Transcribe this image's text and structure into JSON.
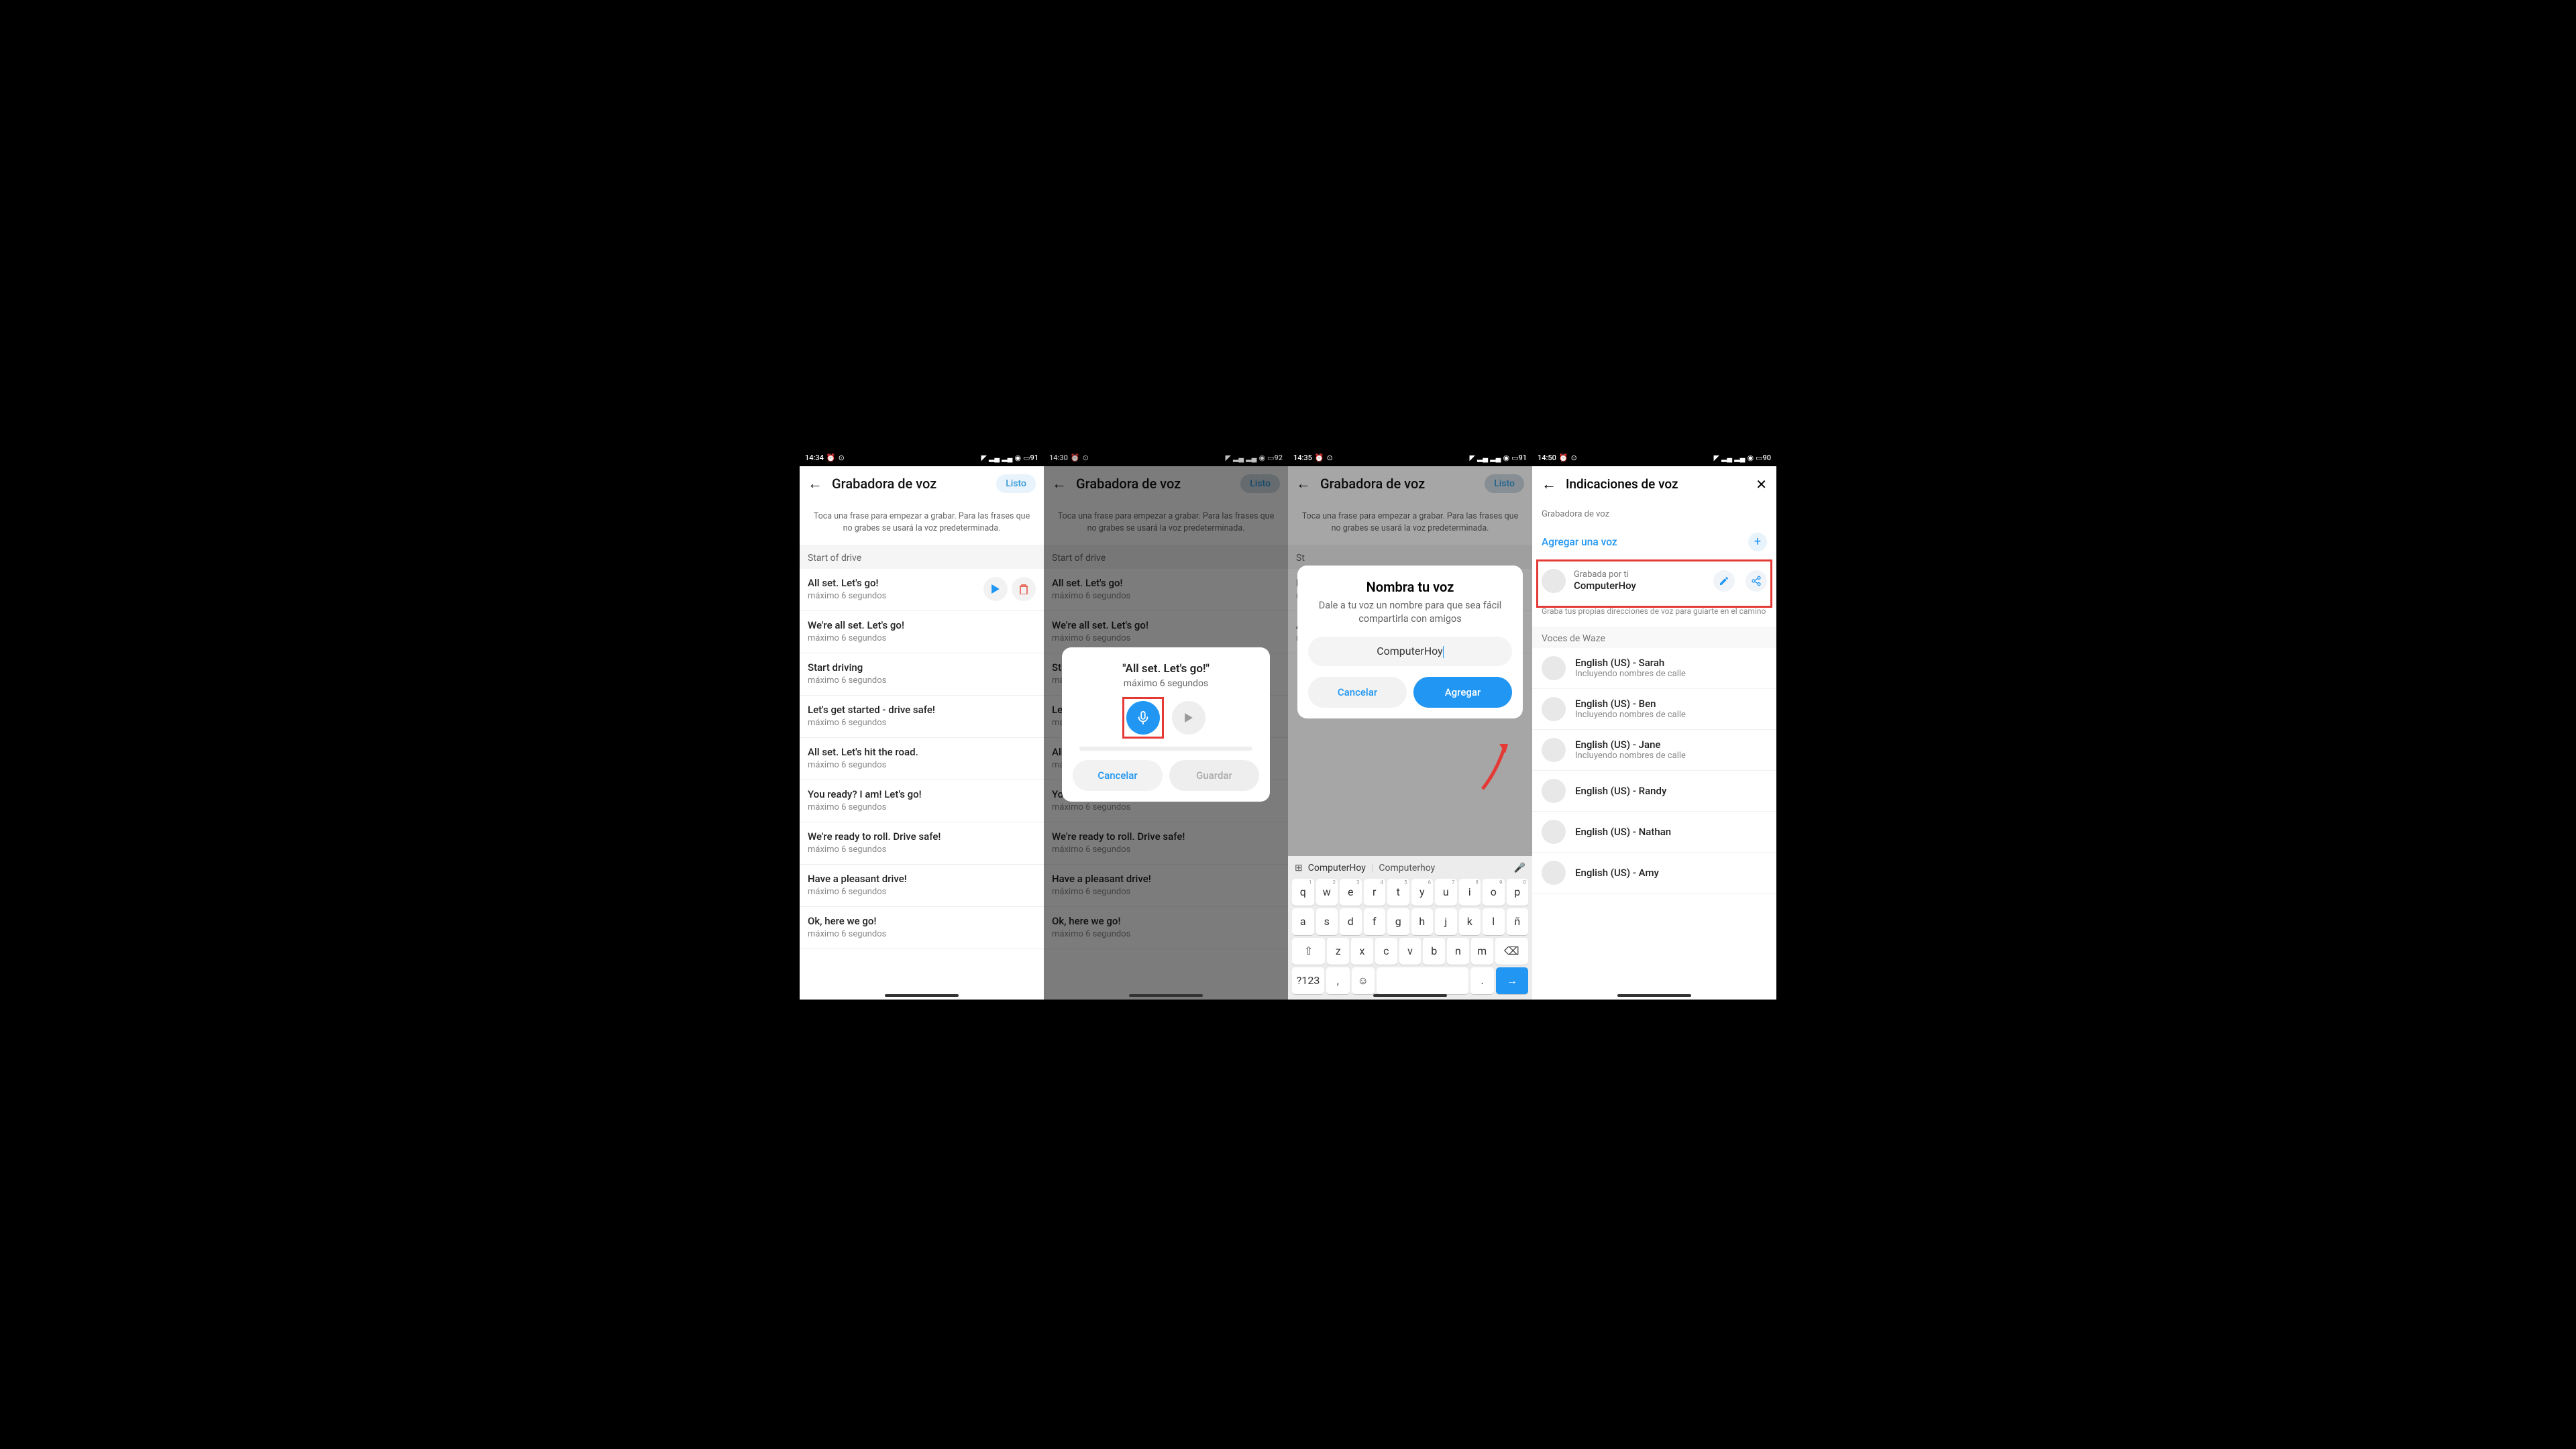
{
  "screens": [
    {
      "time": "14:34",
      "battery": "91"
    },
    {
      "time": "14:30",
      "battery": "92"
    },
    {
      "time": "14:35",
      "battery": "91"
    },
    {
      "time": "14:50",
      "battery": "90"
    }
  ],
  "app_title": "Grabadora de voz",
  "listo": "Listo",
  "help": "Toca una frase para empezar a grabar. Para las frases que no grabes se usará la voz predeterminada.",
  "section": "Start of drive",
  "duration": "máximo 6 segundos",
  "phrases": [
    "All set. Let's go!",
    "We're all set. Let's go!",
    "Start driving",
    "Let's get started - drive safe!",
    "All set. Let's hit the road.",
    "You ready? I am! Let's go!",
    "We're ready to roll. Drive safe!",
    "Have a pleasant drive!",
    "Ok, here we go!"
  ],
  "rec_dialog": {
    "title": "\"All set. Let's go!\"",
    "sub": "máximo 6 segundos",
    "cancel": "Cancelar",
    "save": "Guardar"
  },
  "name_dialog": {
    "title": "Nombra tu voz",
    "sub": "Dale a tu voz un nombre para que sea fácil compartirla con amigos",
    "input": "ComputerHoy",
    "cancel": "Cancelar",
    "add": "Agregar"
  },
  "keyboard": {
    "suggest1": "ComputerHoy",
    "suggest2": "Computerhoy",
    "row1": [
      "q",
      "w",
      "e",
      "r",
      "t",
      "y",
      "u",
      "i",
      "o",
      "p"
    ],
    "nums": [
      "1",
      "2",
      "3",
      "4",
      "5",
      "6",
      "7",
      "8",
      "9",
      "0"
    ],
    "row2": [
      "a",
      "s",
      "d",
      "f",
      "g",
      "h",
      "j",
      "k",
      "l",
      "ñ"
    ],
    "row3": [
      "z",
      "x",
      "c",
      "v",
      "b",
      "n",
      "m"
    ],
    "sym": "?123"
  },
  "screen4": {
    "title": "Indicaciones de voz",
    "sub": "Grabadora de voz",
    "add": "Agregar una voz",
    "recorded_by": "Grabada por ti",
    "my_voice": "ComputerHoy",
    "hint": "Graba tus propias direcciones de voz para guiarte en el camino",
    "waze_header": "Voces de Waze",
    "street_sub": "Incluyendo nombres de calle",
    "voices": [
      {
        "name": "English (US) - Sarah",
        "sub": true
      },
      {
        "name": "English (US) - Ben",
        "sub": true
      },
      {
        "name": "English (US) - Jane",
        "sub": true
      },
      {
        "name": "English (US) - Randy",
        "sub": false
      },
      {
        "name": "English (US) - Nathan",
        "sub": false
      },
      {
        "name": "English (US) - Amy",
        "sub": false
      }
    ]
  }
}
